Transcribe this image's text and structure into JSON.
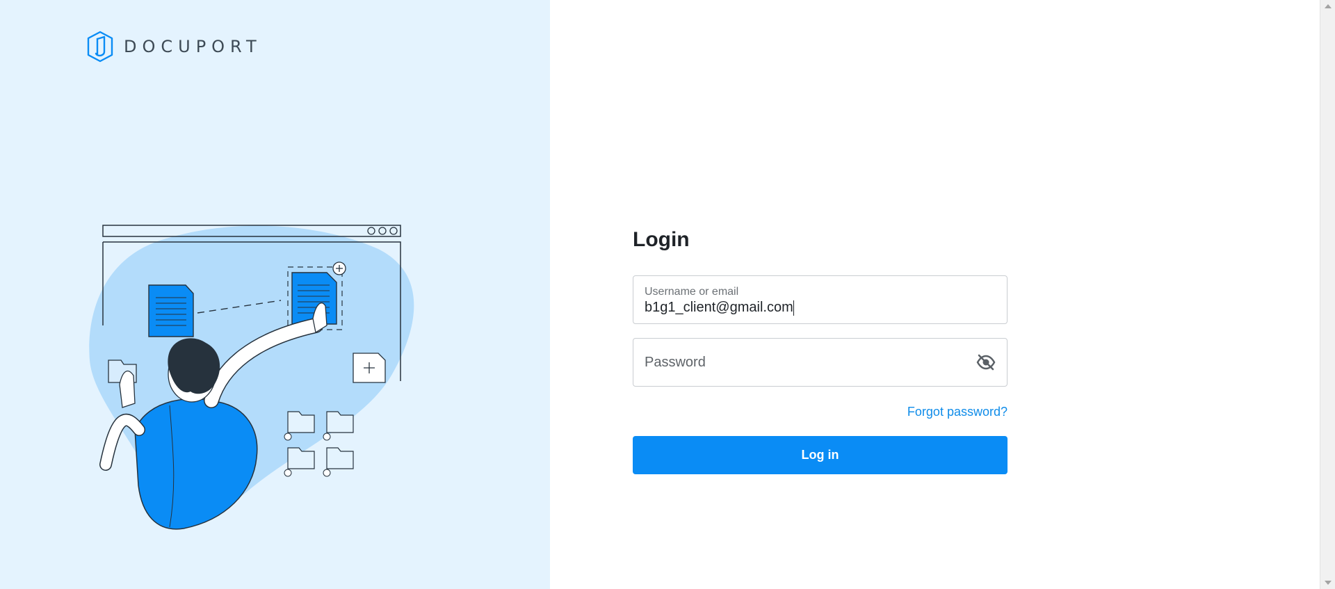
{
  "brand": {
    "name": "DOCUPORT",
    "logo_icon": "docuport-logo-icon"
  },
  "login": {
    "title": "Login",
    "username": {
      "label": "Username or email",
      "value": "b1g1_client@gmail.com"
    },
    "password": {
      "placeholder": "Password",
      "toggle_icon": "eye-slash-icon"
    },
    "forgot_label": "Forgot password?",
    "submit_label": "Log in"
  },
  "colors": {
    "accent": "#0a8cf5",
    "link": "#0f8ce9",
    "left_panel_bg": "#e4f3fe"
  }
}
